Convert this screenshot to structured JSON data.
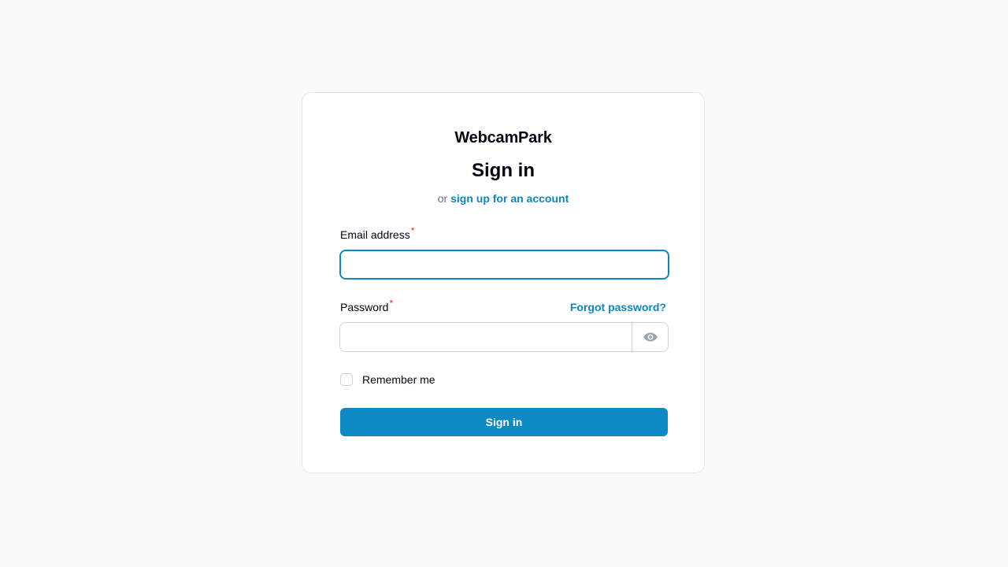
{
  "brand": "WebcamPark",
  "heading": "Sign in",
  "subtitle": {
    "prefix": "or",
    "link": "sign up for an account"
  },
  "form": {
    "email_label": "Email address",
    "email_value": "",
    "password_label": "Password",
    "password_value": "",
    "required_marker": "*",
    "forgot_link": "Forgot password?",
    "password_toggle_icon": "eye-icon",
    "remember_label": "Remember me",
    "remember_checked": false,
    "submit_label": "Sign in"
  },
  "colors": {
    "accent": "#0e87bf",
    "button": "#0e8ac2",
    "background": "#f9fafb",
    "required": "#dc2626"
  }
}
